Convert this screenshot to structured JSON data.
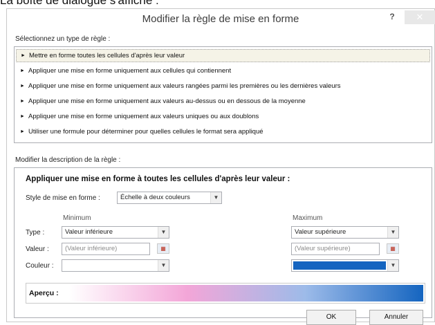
{
  "caption": "La boîte de dialogue s'affiche :",
  "dialog": {
    "title": "Modifier la règle de mise en forme",
    "help_label": "?",
    "close_label": "✕"
  },
  "rule_type": {
    "label": "Sélectionnez un type de règle :",
    "items": [
      "Mettre en forme toutes les cellules d'après leur valeur",
      "Appliquer une mise en forme uniquement aux cellules qui contiennent",
      "Appliquer une mise en forme uniquement aux valeurs rangées parmi les premières ou les dernières valeurs",
      "Appliquer une mise en forme uniquement aux valeurs au-dessus ou en dessous de la moyenne",
      "Appliquer une mise en forme uniquement aux valeurs uniques ou aux doublons",
      "Utiliser une formule pour déterminer pour quelles cellules le format sera appliqué"
    ],
    "selected_index": 0
  },
  "description": {
    "label": "Modifier la description de la règle :",
    "heading": "Appliquer une mise en forme à toutes les cellules d'après leur valeur :",
    "style_label": "Style de mise en forme :",
    "style_value": "Échelle à deux couleurs",
    "minimum_header": "Minimum",
    "maximum_header": "Maximum",
    "type_label": "Type :",
    "value_label": "Valeur :",
    "color_label": "Couleur :",
    "min_type": "Valeur inférieure",
    "max_type": "Valeur supérieure",
    "min_value": "(Valeur inférieure)",
    "max_value": "(Valeur supérieure)",
    "min_color": "#ffffff",
    "max_color": "#1565c0",
    "preview_label": "Aperçu :",
    "preview_gradient": [
      "#ffffff",
      "#f3a6d8",
      "#9dbbe9",
      "#1565c0"
    ]
  },
  "buttons": {
    "ok": "OK",
    "cancel": "Annuler"
  }
}
